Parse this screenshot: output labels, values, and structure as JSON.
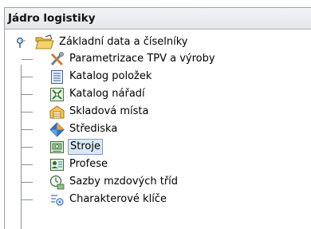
{
  "panel": {
    "title": "Jádro logistiky"
  },
  "tree": {
    "root": {
      "label": "Základní data a číselníky",
      "icon": "open-folder-icon",
      "expanded": true
    },
    "items": [
      {
        "label": "Parametrizace TPV a výroby",
        "icon": "tools-icon"
      },
      {
        "label": "Katalog položek",
        "icon": "catalog-list-icon"
      },
      {
        "label": "Katalog nářadí",
        "icon": "tool-catalog-icon"
      },
      {
        "label": "Skladová místa",
        "icon": "warehouse-icon"
      },
      {
        "label": "Střediska",
        "icon": "cost-center-icon"
      },
      {
        "label": "Stroje",
        "icon": "machine-icon",
        "selected": true
      },
      {
        "label": "Profese",
        "icon": "profession-icon"
      },
      {
        "label": "Sazby mzdových tříd",
        "icon": "wage-rates-icon"
      },
      {
        "label": "Charakterové klíče",
        "icon": "character-key-icon"
      }
    ]
  },
  "colors": {
    "selection_bg": "#dbe8f8",
    "selection_border": "#7a9cc6",
    "header_bg": "#e8ebee"
  }
}
